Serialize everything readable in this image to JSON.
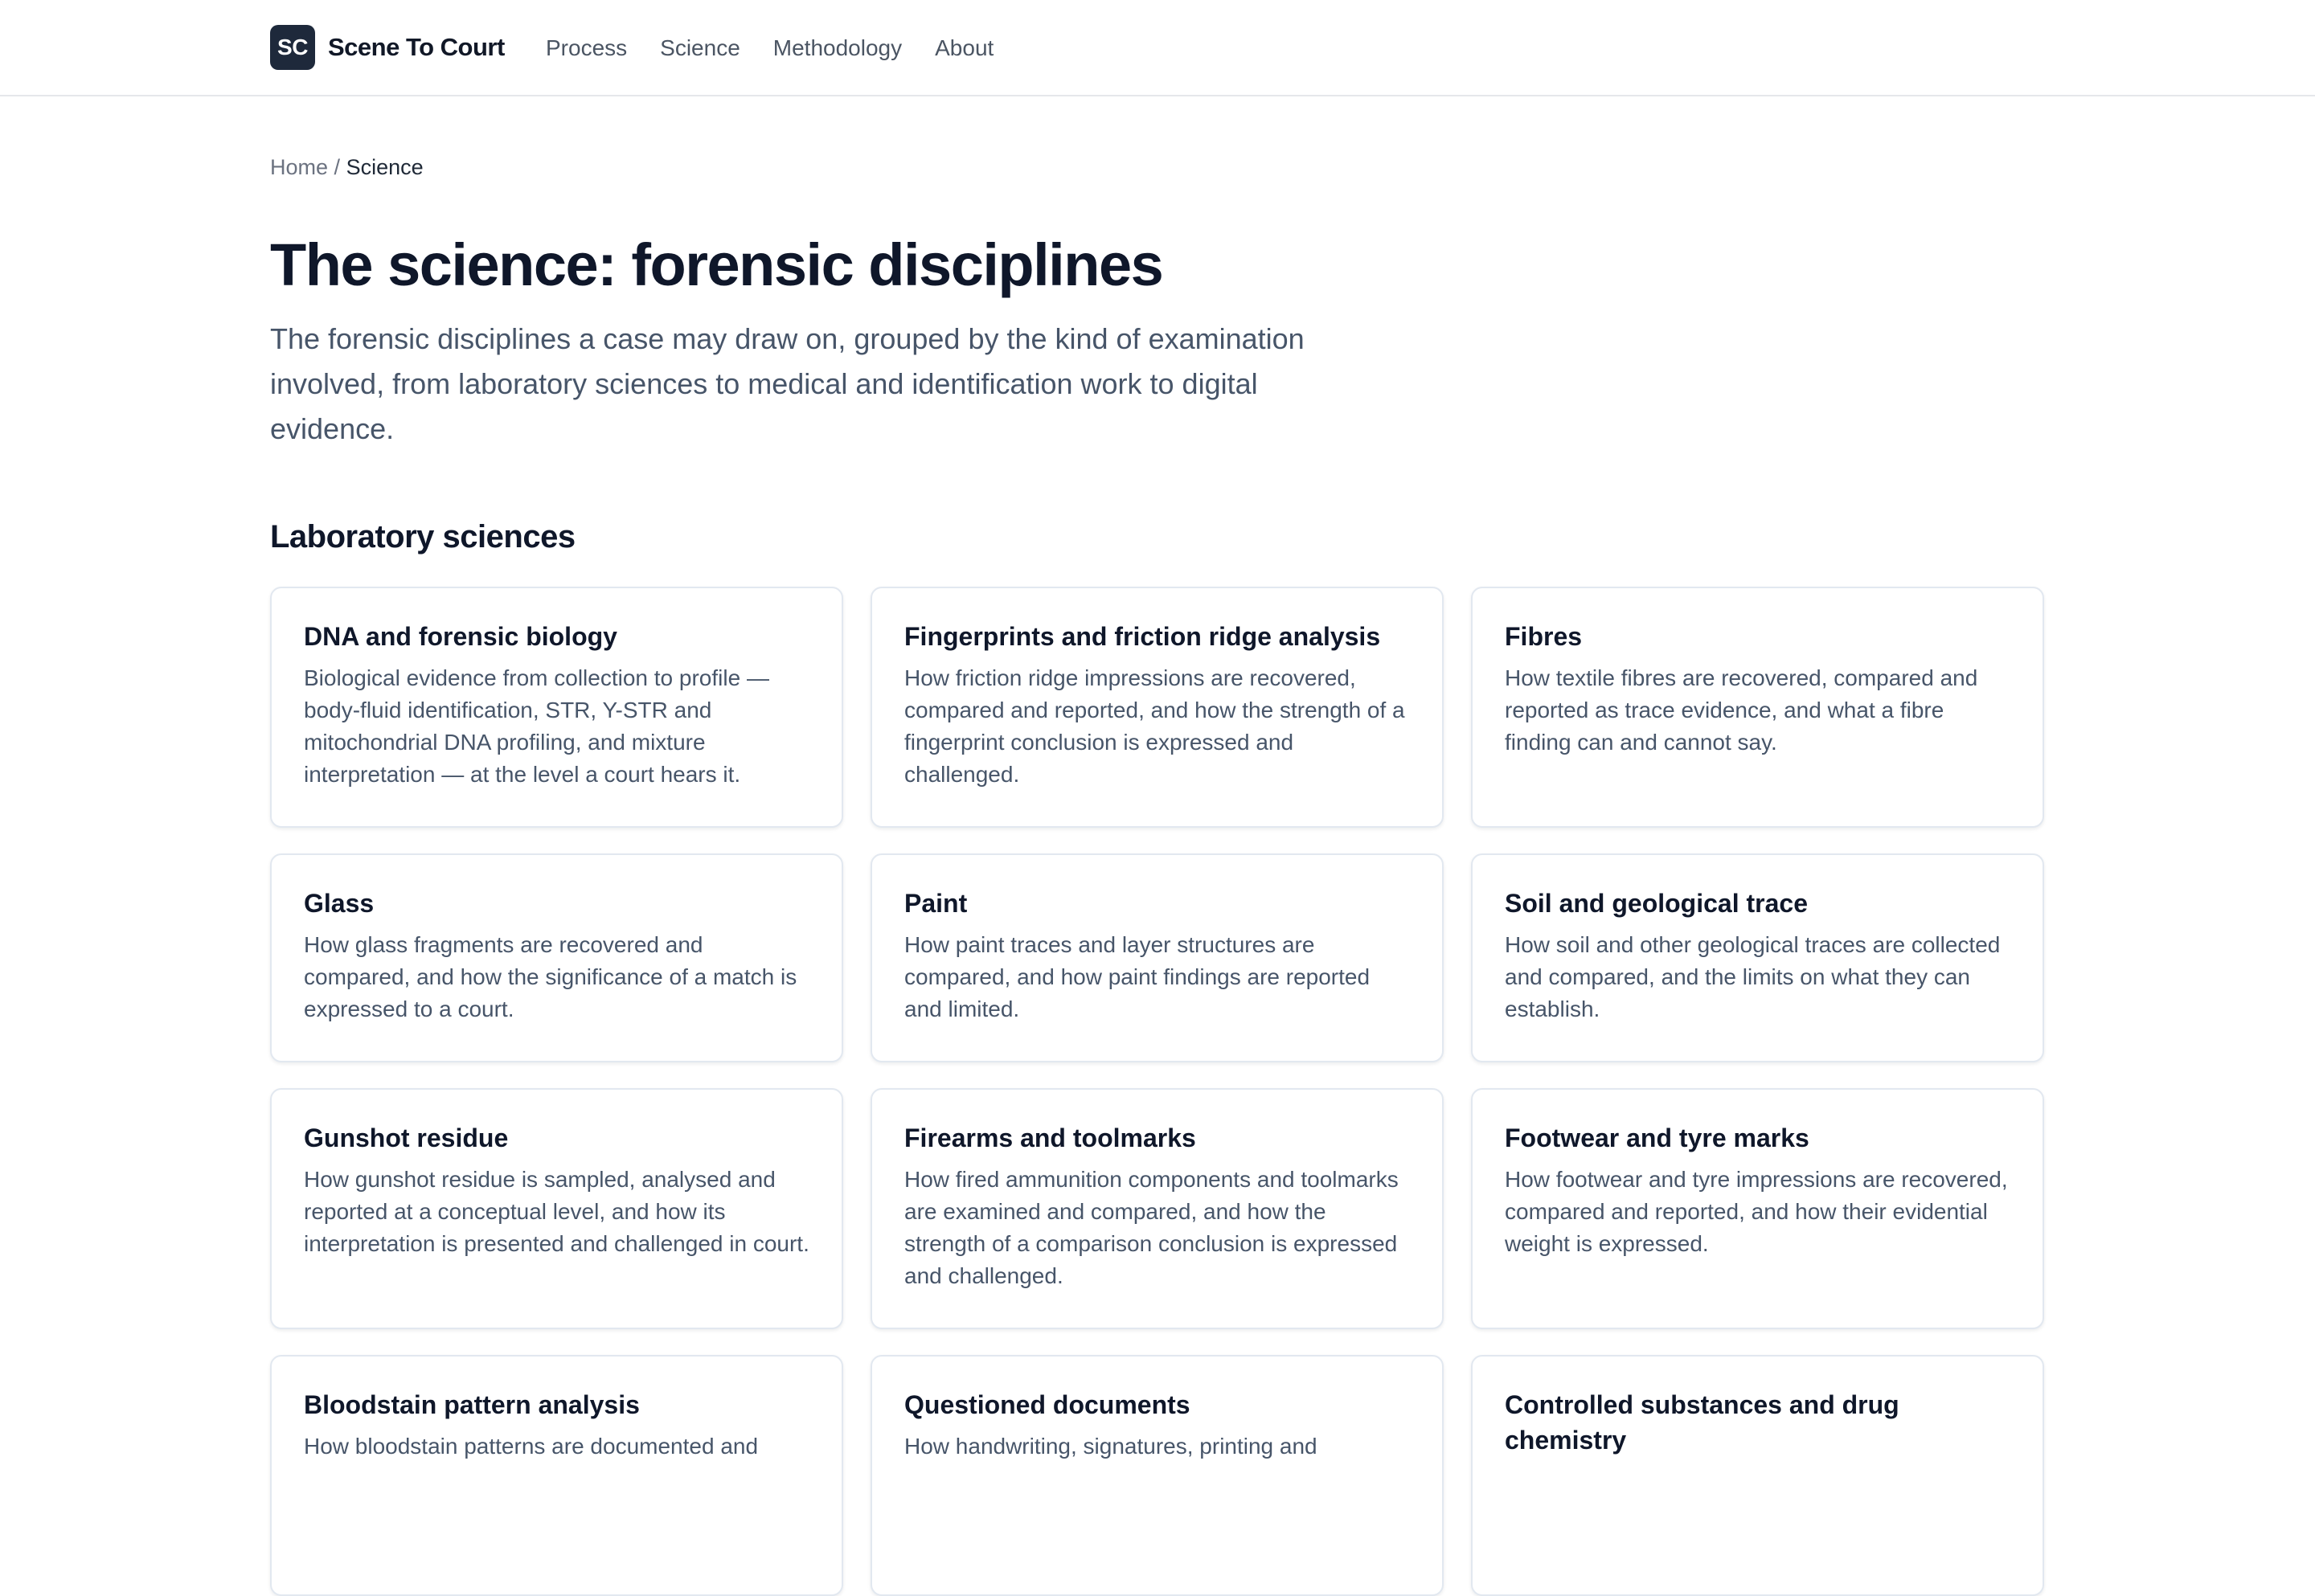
{
  "header": {
    "logo_text": "SC",
    "site_name": "Scene To Court",
    "nav": [
      {
        "label": "Process"
      },
      {
        "label": "Science"
      },
      {
        "label": "Methodology"
      },
      {
        "label": "About"
      }
    ]
  },
  "breadcrumb": {
    "home": "Home",
    "separator": "/",
    "current": "Science"
  },
  "page": {
    "title": "The science: forensic disciplines",
    "intro": "The forensic disciplines a case may draw on, grouped by the kind of examination involved, from laboratory sciences to medical and identification work to digital evidence."
  },
  "section": {
    "title": "Laboratory sciences",
    "cards": [
      {
        "title": "DNA and forensic biology",
        "description": "Biological evidence from collection to profile — body-fluid identification, STR, Y-STR and mitochondrial DNA profiling, and mixture interpretation — at the level a court hears it."
      },
      {
        "title": "Fingerprints and friction ridge analysis",
        "description": "How friction ridge impressions are recovered, compared and reported, and how the strength of a fingerprint conclusion is expressed and challenged."
      },
      {
        "title": "Fibres",
        "description": "How textile fibres are recovered, compared and reported as trace evidence, and what a fibre finding can and cannot say."
      },
      {
        "title": "Glass",
        "description": "How glass fragments are recovered and compared, and how the significance of a match is expressed to a court."
      },
      {
        "title": "Paint",
        "description": "How paint traces and layer structures are compared, and how paint findings are reported and limited."
      },
      {
        "title": "Soil and geological trace",
        "description": "How soil and other geological traces are collected and compared, and the limits on what they can establish."
      },
      {
        "title": "Gunshot residue",
        "description": "How gunshot residue is sampled, analysed and reported at a conceptual level, and how its interpretation is presented and challenged in court."
      },
      {
        "title": "Firearms and toolmarks",
        "description": "How fired ammunition components and toolmarks are examined and compared, and how the strength of a comparison conclusion is expressed and challenged."
      },
      {
        "title": "Footwear and tyre marks",
        "description": "How footwear and tyre impressions are recovered, compared and reported, and how their evidential weight is expressed."
      },
      {
        "title": "Bloodstain pattern analysis",
        "description": "How bloodstain patterns are documented and"
      },
      {
        "title": "Questioned documents",
        "description": "How handwriting, signatures, printing and"
      },
      {
        "title": "Controlled substances and drug chemistry",
        "description": ""
      }
    ]
  }
}
